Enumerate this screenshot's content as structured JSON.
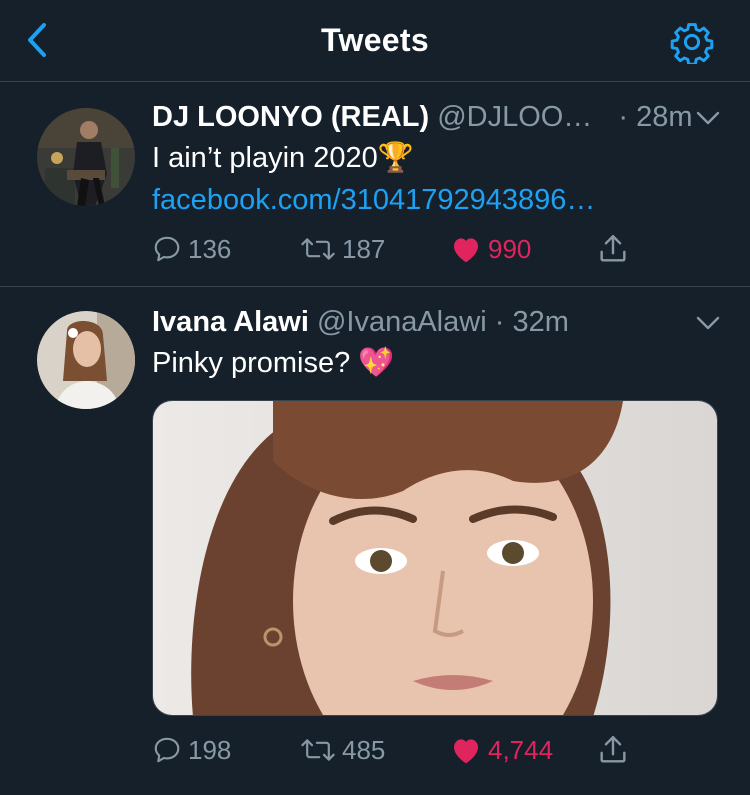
{
  "header": {
    "title": "Tweets"
  },
  "tweets": [
    {
      "name": "DJ LOONYO (REAL)",
      "handle": "@DJLOO…",
      "sep": "·",
      "time": "28m",
      "text": "I ain’t playin 2020🏆",
      "link": "facebook.com/31041792943896…",
      "replies": "136",
      "retweets": "187",
      "likes": "990",
      "liked": true
    },
    {
      "name": "Ivana Alawi",
      "handle": "@IvanaAlawi",
      "sep": "·",
      "time": "32m",
      "text": "Pinky promise? 💖",
      "replies": "198",
      "retweets": "485",
      "likes": "4,744",
      "liked": true
    }
  ],
  "colors": {
    "background": "#15202b",
    "accent": "#1da1f2",
    "like": "#e0245e",
    "secondary": "#8899a6"
  },
  "icons": {
    "back": "chevron-left-icon",
    "settings": "gear-icon",
    "reply": "comment-icon",
    "retweet": "retweet-icon",
    "like": "heart-icon",
    "share": "share-icon"
  }
}
